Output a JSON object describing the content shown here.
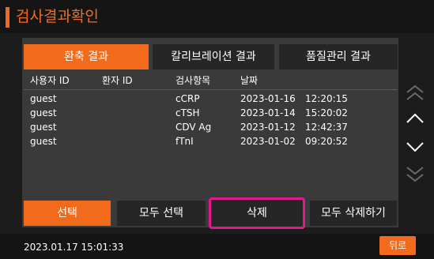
{
  "header": {
    "title": "검사결과확인"
  },
  "tabs": [
    {
      "label": "환축 결과",
      "active": true
    },
    {
      "label": "칼리브레이션 결과",
      "active": false
    },
    {
      "label": "품질관리 결과",
      "active": false
    }
  ],
  "table": {
    "columns": [
      "사용자 ID",
      "환자 ID",
      "검사항목",
      "날짜"
    ],
    "rows": [
      {
        "user": "guest",
        "patient": "",
        "item": "cCRP",
        "date": "2023-01-16",
        "time": "12:20:15"
      },
      {
        "user": "guest",
        "patient": "",
        "item": "cTSH",
        "date": "2023-01-14",
        "time": "15:20:02"
      },
      {
        "user": "guest",
        "patient": "",
        "item": "CDV Ag",
        "date": "2023-01-12",
        "time": "12:42:37"
      },
      {
        "user": "guest",
        "patient": "",
        "item": "fTnI",
        "date": "2023-01-02",
        "time": "09:20:52"
      }
    ]
  },
  "scroll": {
    "icons": [
      "double-chevron-up-icon",
      "chevron-up-icon",
      "chevron-down-icon",
      "double-chevron-down-icon"
    ]
  },
  "actions": {
    "select": "선택",
    "select_all": "모두 선택",
    "delete": "삭제",
    "delete_all": "모두 삭제하기"
  },
  "footer": {
    "datetime": "2023.01.17 15:01:33",
    "back": "뒤로"
  },
  "colors": {
    "accent": "#f26b1d",
    "highlight": "#e01a8c",
    "panel": "#3a3a3a",
    "background": "#1c1c1c"
  }
}
